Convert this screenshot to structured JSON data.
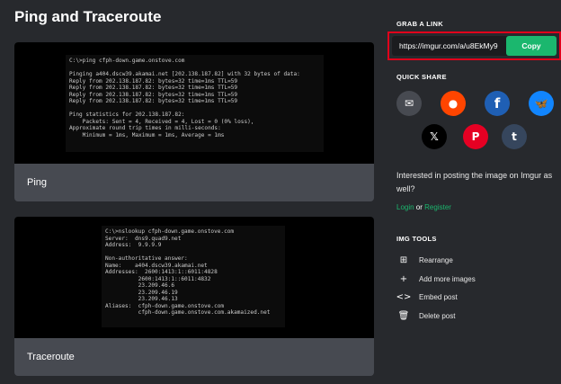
{
  "page_title": "Ping and Traceroute",
  "posts": [
    {
      "caption": "Ping",
      "terminal": [
        "C:\\>ping cfph-down.game.onstove.com",
        "",
        "Pinging a404.dscw39.akamai.net [202.138.187.82] with 32 bytes of data:",
        "Reply from 202.138.187.82: bytes=32 time=1ms TTL=59",
        "Reply from 202.138.187.82: bytes=32 time=1ms TTL=59",
        "Reply from 202.138.187.82: bytes=32 time=1ms TTL=59",
        "Reply from 202.138.187.82: bytes=32 time=1ms TTL=59",
        "",
        "Ping statistics for 202.138.187.82:",
        "    Packets: Sent = 4, Received = 4, Lost = 0 (0% loss),",
        "Approximate round trip times in milli-seconds:",
        "    Minimum = 1ms, Maximum = 1ms, Average = 1ms"
      ]
    },
    {
      "caption": "Traceroute",
      "terminal": [
        "C:\\>nslookup cfph-down.game.onstove.com",
        "Server:  dns9.quad9.net",
        "Address:  9.9.9.9",
        "",
        "Non-authoritative answer:",
        "Name:    a404.dscw39.akamai.net",
        "Addresses:  2600:1413:1::6011:4828",
        "          2600:1413:1::6011:4832",
        "          23.209.46.6",
        "          23.209.46.19",
        "          23.209.46.13",
        "Aliases:  cfph-down.game.onstove.com",
        "          cfph-down.game.onstove.com.akamaized.net"
      ]
    }
  ],
  "sidebar": {
    "grab_title": "GRAB A LINK",
    "link_url": "https://imgur.com/a/u8EkMy9",
    "copy_label": "Copy",
    "quick_share_title": "QUICK SHARE",
    "share_icons": [
      {
        "icon": "mail-icon",
        "bg": "#474a51",
        "glyph": "✉"
      },
      {
        "icon": "reddit-icon",
        "bg": "#ff4500",
        "glyph": "●"
      },
      {
        "icon": "facebook-icon",
        "bg": "#1f5fb4",
        "glyph": "f"
      },
      {
        "icon": "bluesky-icon",
        "bg": "#1185fe",
        "glyph": "🦋"
      },
      {
        "icon": "x-icon",
        "bg": "#000000",
        "glyph": "𝕏"
      },
      {
        "icon": "pinterest-icon",
        "bg": "#e60023",
        "glyph": "P"
      },
      {
        "icon": "tumblr-icon",
        "bg": "#36465d",
        "glyph": "t"
      }
    ],
    "interested_text": "Interested in posting the image on Imgur as well?",
    "login_label": "Login",
    "or_label": " or ",
    "register_label": "Register",
    "tools_title": "IMG TOOLS",
    "tools": [
      {
        "label": "Rearrange",
        "icon": "rearrange-icon",
        "glyph": "⊞"
      },
      {
        "label": "Add more images",
        "icon": "plus-icon",
        "glyph": "+"
      },
      {
        "label": "Embed post",
        "icon": "embed-icon",
        "glyph": "<>"
      },
      {
        "label": "Delete post",
        "icon": "trash-icon",
        "glyph": "🗑"
      }
    ]
  }
}
